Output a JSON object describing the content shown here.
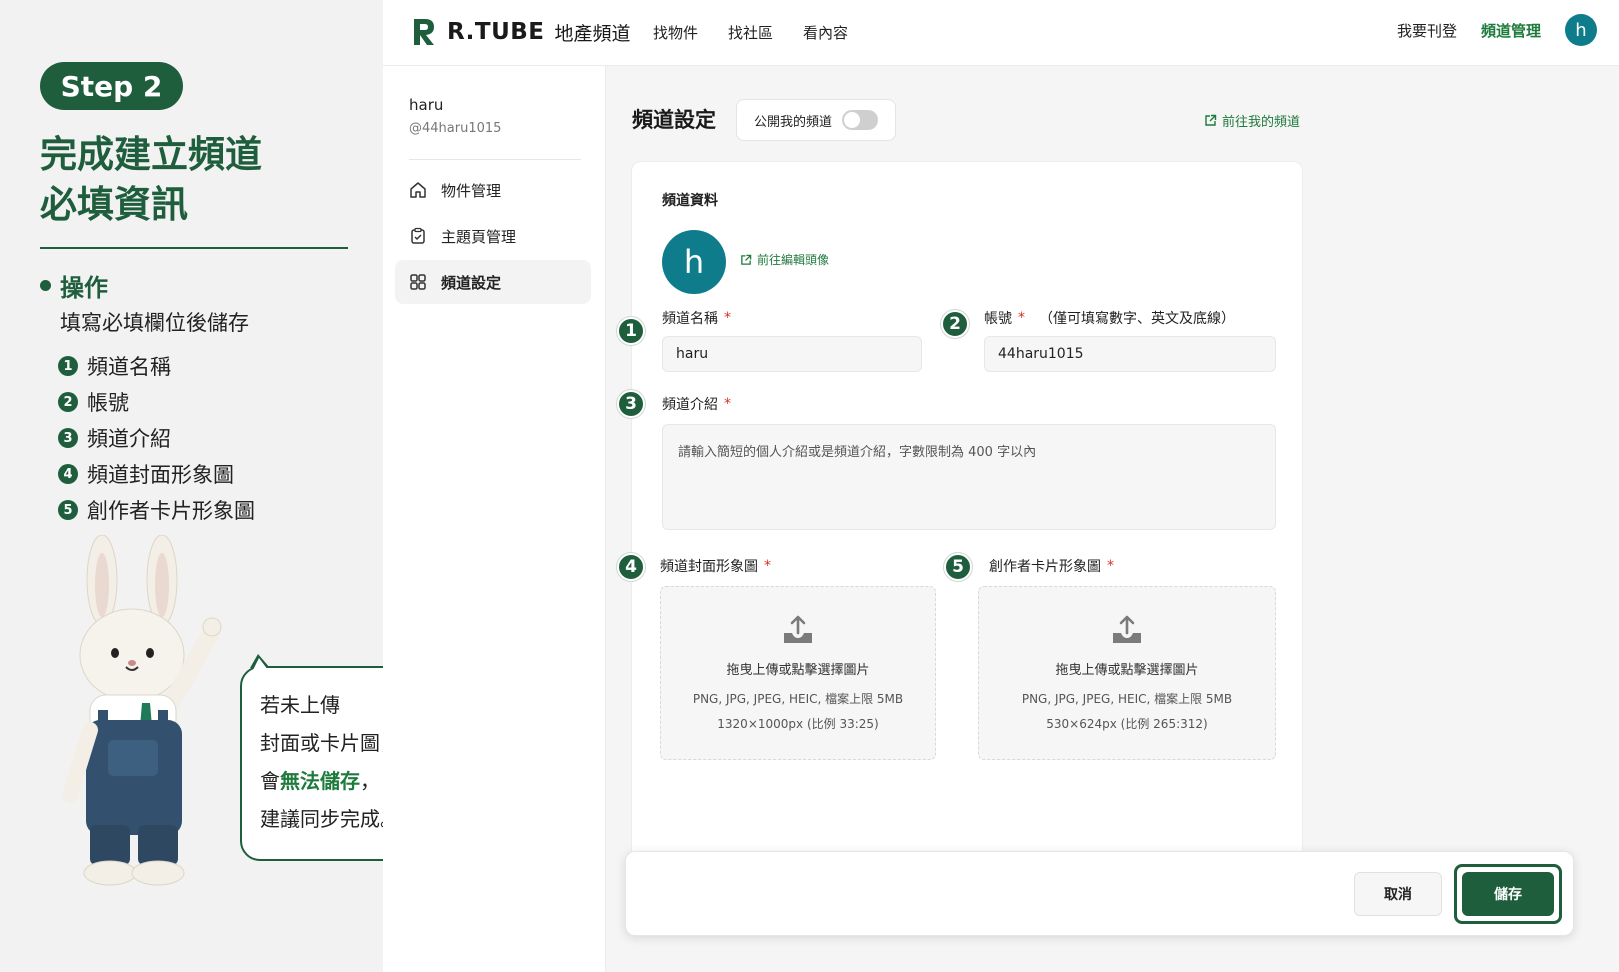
{
  "guide": {
    "step_label": "Step 2",
    "title_line1": "完成建立頻道",
    "title_line2": "必填資訊",
    "operation_heading": "操作",
    "operation_desc": "填寫必填欄位後儲存",
    "steps": [
      {
        "num": "1",
        "label": "頻道名稱"
      },
      {
        "num": "2",
        "label": "帳號"
      },
      {
        "num": "3",
        "label": "頻道介紹"
      },
      {
        "num": "4",
        "label": "頻道封面形象圖"
      },
      {
        "num": "5",
        "label": "創作者卡片形象圖"
      }
    ],
    "bubble": {
      "line1": "若未上傳",
      "line2": "封面或卡片圖，",
      "line3_prefix": "會",
      "line3_strong": "無法儲存",
      "line3_suffix": "，",
      "line4": "建議同步完成。"
    }
  },
  "topbar": {
    "logo_text": "R.TUBE",
    "logo_sub": "地產頻道",
    "nav": [
      "找物件",
      "找社區",
      "看內容"
    ],
    "publish_link": "我要刊登",
    "manage_link": "頻道管理",
    "avatar_letter": "h"
  },
  "sidebar": {
    "user_name": "haru",
    "user_handle": "@44haru1015",
    "items": [
      {
        "label": "物件管理",
        "icon": "home-icon"
      },
      {
        "label": "主題頁管理",
        "icon": "clipboard-icon"
      },
      {
        "label": "頻道設定",
        "icon": "grid-icon"
      }
    ]
  },
  "settings": {
    "title": "頻道設定",
    "public_toggle_label": "公開我的頻道",
    "public_toggle_on": false,
    "goto_channel": "前往我的頻道",
    "section_label": "頻道資料",
    "avatar_letter": "h",
    "edit_avatar": "前往編輯頭像",
    "channel_name_label": "頻道名稱",
    "channel_name_value": "haru",
    "account_label": "帳號",
    "account_hint": "（僅可填寫數字、英文及底線）",
    "account_value": "44haru1015",
    "intro_label": "頻道介紹",
    "intro_placeholder": "請輸入簡短的個人介紹或是頻道介紹，字數限制為 400 字以內",
    "required_mark": "*",
    "cover_label": "頻道封面形象圖",
    "card_label": "創作者卡片形象圖",
    "cover_upload": {
      "line1": "拖曳上傳或點擊選擇圖片",
      "line2": "PNG, JPG, JPEG, HEIC, 檔案上限 5MB",
      "line3": "1320×1000px (比例 33:25)"
    },
    "card_upload": {
      "line1": "拖曳上傳或點擊選擇圖片",
      "line2": "PNG, JPG, JPEG, HEIC, 檔案上限 5MB",
      "line3": "530×624px (比例 265:312)"
    },
    "markers": [
      "1",
      "2",
      "3",
      "4",
      "5"
    ]
  },
  "actions": {
    "cancel": "取消",
    "save": "儲存"
  },
  "colors": {
    "brand_green": "#1f5e3d",
    "link_green": "#1f7a3d",
    "avatar_teal": "#0f7c8c",
    "required_red": "#d93025"
  }
}
